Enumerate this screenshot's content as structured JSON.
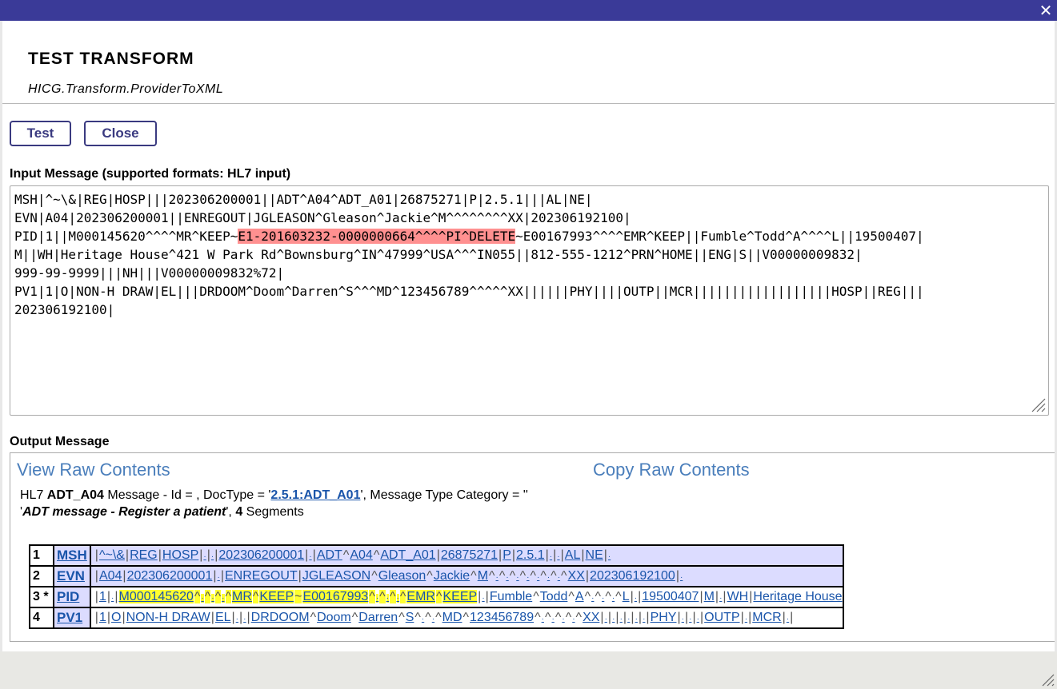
{
  "title": "TEST TRANSFORM",
  "subtitle": "HICG.Transform.ProviderToXML",
  "close_glyph": "✕",
  "buttons": {
    "test": "Test",
    "close": "Close"
  },
  "input": {
    "label": "Input Message (supported formats: HL7 input)",
    "lines": [
      "MSH|^~\\&|REG|HOSP|||202306200001||ADT^A04^ADT_A01|26875271|P|2.5.1|||AL|NE|",
      "EVN|A04|202306200001||ENREGOUT|JGLEASON^Gleason^Jackie^M^^^^^^^^XX|202306192100|",
      "PID|1||M000145620^^^^MR^KEEP~",
      "E1-201603232-0000000664^^^^PI^DELETE",
      "~E00167993^^^^EMR^KEEP||Fumble^Todd^A^^^^L||19500407|",
      "M||WH|Heritage House^421 W Park Rd^Bownsburg^IN^47999^USA^^^IN055||812-555-1212^PRN^HOME||ENG|S||V00000009832|",
      "999-99-9999|||NH|||V00000009832%72|",
      "PV1|1|O|NON-H DRAW|EL|||DRDOOM^Doom^Darren^S^^^MD^123456789^^^^^XX||||||PHY||||OUTP||MCR||||||||||||||||||HOSP||REG|||",
      "202306192100|"
    ]
  },
  "output": {
    "label": "Output Message",
    "view_raw": "View Raw Contents",
    "copy_raw": "Copy Raw Contents",
    "summary": {
      "prefix": "HL7 ",
      "msg_type": "ADT_A04",
      "mid": " Message - Id = , DocType = '",
      "doctype": "2.5.1:ADT_A01",
      "after_doctype": "', Message Type Category = ''",
      "quote_open": "'",
      "description": "ADT message - Register a patient",
      "after_desc": "', ",
      "segment_count": "4",
      "suffix": " Segments"
    },
    "segments": [
      {
        "num": "1",
        "name": "MSH",
        "tokens": [
          [
            "s",
            "|"
          ],
          [
            "f",
            "^~\\&"
          ],
          [
            "s",
            "|"
          ],
          [
            "f",
            "REG"
          ],
          [
            "s",
            "|"
          ],
          [
            "f",
            "HOSP"
          ],
          [
            "s",
            "|"
          ],
          [
            "e",
            "·"
          ],
          [
            "s",
            "|"
          ],
          [
            "e",
            "·"
          ],
          [
            "s",
            "|"
          ],
          [
            "f",
            "202306200001"
          ],
          [
            "s",
            "|"
          ],
          [
            "e",
            "·"
          ],
          [
            "s",
            "|"
          ],
          [
            "f",
            "ADT"
          ],
          [
            "s",
            "^"
          ],
          [
            "f",
            "A04"
          ],
          [
            "s",
            "^"
          ],
          [
            "f",
            "ADT_A01"
          ],
          [
            "s",
            "|"
          ],
          [
            "f",
            "26875271"
          ],
          [
            "s",
            "|"
          ],
          [
            "f",
            "P"
          ],
          [
            "s",
            "|"
          ],
          [
            "f",
            "2.5.1"
          ],
          [
            "s",
            "|"
          ],
          [
            "e",
            "·"
          ],
          [
            "s",
            "|"
          ],
          [
            "e",
            "·"
          ],
          [
            "s",
            "|"
          ],
          [
            "f",
            "AL"
          ],
          [
            "s",
            "|"
          ],
          [
            "f",
            "NE"
          ],
          [
            "s",
            "|"
          ],
          [
            "e",
            "·"
          ]
        ]
      },
      {
        "num": "2",
        "name": "EVN",
        "tokens": [
          [
            "s",
            "|"
          ],
          [
            "f",
            "A04"
          ],
          [
            "s",
            "|"
          ],
          [
            "f",
            "202306200001"
          ],
          [
            "s",
            "|"
          ],
          [
            "e",
            "·"
          ],
          [
            "s",
            "|"
          ],
          [
            "f",
            "ENREGOUT"
          ],
          [
            "s",
            "|"
          ],
          [
            "f",
            "JGLEASON"
          ],
          [
            "s",
            "^"
          ],
          [
            "f",
            "Gleason"
          ],
          [
            "s",
            "^"
          ],
          [
            "f",
            "Jackie"
          ],
          [
            "s",
            "^"
          ],
          [
            "f",
            "M"
          ],
          [
            "s",
            "^"
          ],
          [
            "e",
            "·"
          ],
          [
            "s",
            "^"
          ],
          [
            "e",
            "·"
          ],
          [
            "s",
            "^"
          ],
          [
            "e",
            "·"
          ],
          [
            "s",
            "^"
          ],
          [
            "e",
            "·"
          ],
          [
            "s",
            "^"
          ],
          [
            "e",
            "·"
          ],
          [
            "s",
            "^"
          ],
          [
            "e",
            "·"
          ],
          [
            "s",
            "^"
          ],
          [
            "e",
            "·"
          ],
          [
            "s",
            "^"
          ],
          [
            "f",
            "XX"
          ],
          [
            "s",
            "|"
          ],
          [
            "f",
            "202306192100"
          ],
          [
            "s",
            "|"
          ],
          [
            "e",
            "·"
          ]
        ]
      },
      {
        "num": "3 *",
        "name": "PID",
        "tokens": [
          [
            "s",
            "|"
          ],
          [
            "f",
            "1"
          ],
          [
            "s",
            "|"
          ],
          [
            "e",
            "·"
          ],
          [
            "s",
            "|"
          ],
          [
            "yf",
            "M000145620"
          ],
          [
            "ys",
            "^"
          ],
          [
            "ye",
            "·"
          ],
          [
            "ys",
            "^"
          ],
          [
            "ye",
            "·"
          ],
          [
            "ys",
            "^"
          ],
          [
            "ye",
            "·"
          ],
          [
            "ys",
            "^"
          ],
          [
            "yf",
            "MR"
          ],
          [
            "ys",
            "^"
          ],
          [
            "yf",
            "KEEP"
          ],
          [
            "ys",
            "~"
          ],
          [
            "yf",
            "E00167993"
          ],
          [
            "ys",
            "^"
          ],
          [
            "ye",
            "·"
          ],
          [
            "ys",
            "^"
          ],
          [
            "ye",
            "·"
          ],
          [
            "ys",
            "^"
          ],
          [
            "ye",
            "·"
          ],
          [
            "ys",
            "^"
          ],
          [
            "yf",
            "EMR"
          ],
          [
            "ys",
            "^"
          ],
          [
            "yf",
            "KEEP"
          ],
          [
            "s",
            "|"
          ],
          [
            "e",
            "·"
          ],
          [
            "s",
            "|"
          ],
          [
            "f",
            "Fumble"
          ],
          [
            "s",
            "^"
          ],
          [
            "f",
            "Todd"
          ],
          [
            "s",
            "^"
          ],
          [
            "f",
            "A"
          ],
          [
            "s",
            "^"
          ],
          [
            "e",
            "·"
          ],
          [
            "s",
            "^"
          ],
          [
            "e",
            "·"
          ],
          [
            "s",
            "^"
          ],
          [
            "e",
            "·"
          ],
          [
            "s",
            "^"
          ],
          [
            "f",
            "L"
          ],
          [
            "s",
            "|"
          ],
          [
            "e",
            "·"
          ],
          [
            "s",
            "|"
          ],
          [
            "f",
            "19500407"
          ],
          [
            "s",
            "|"
          ],
          [
            "f",
            "M"
          ],
          [
            "s",
            "|"
          ],
          [
            "e",
            "·"
          ],
          [
            "s",
            "|"
          ],
          [
            "f",
            "WH"
          ],
          [
            "s",
            "|"
          ],
          [
            "f",
            "Heritage House"
          ]
        ]
      },
      {
        "num": "4",
        "name": "PV1",
        "tokens": [
          [
            "s",
            "|"
          ],
          [
            "f",
            "1"
          ],
          [
            "s",
            "|"
          ],
          [
            "f",
            "O"
          ],
          [
            "s",
            "|"
          ],
          [
            "f",
            "NON-H DRAW"
          ],
          [
            "s",
            "|"
          ],
          [
            "f",
            "EL"
          ],
          [
            "s",
            "|"
          ],
          [
            "e",
            "·"
          ],
          [
            "s",
            "|"
          ],
          [
            "e",
            "·"
          ],
          [
            "s",
            "|"
          ],
          [
            "f",
            "DRDOOM"
          ],
          [
            "s",
            "^"
          ],
          [
            "f",
            "Doom"
          ],
          [
            "s",
            "^"
          ],
          [
            "f",
            "Darren"
          ],
          [
            "s",
            "^"
          ],
          [
            "f",
            "S"
          ],
          [
            "s",
            "^"
          ],
          [
            "e",
            "·"
          ],
          [
            "s",
            "^"
          ],
          [
            "e",
            "·"
          ],
          [
            "s",
            "^"
          ],
          [
            "f",
            "MD"
          ],
          [
            "s",
            "^"
          ],
          [
            "f",
            "123456789"
          ],
          [
            "s",
            "^"
          ],
          [
            "e",
            "·"
          ],
          [
            "s",
            "^"
          ],
          [
            "e",
            "·"
          ],
          [
            "s",
            "^"
          ],
          [
            "e",
            "·"
          ],
          [
            "s",
            "^"
          ],
          [
            "e",
            "·"
          ],
          [
            "s",
            "^"
          ],
          [
            "f",
            "XX"
          ],
          [
            "s",
            "|"
          ],
          [
            "e",
            "·"
          ],
          [
            "s",
            "|"
          ],
          [
            "e",
            "·"
          ],
          [
            "s",
            "|"
          ],
          [
            "e",
            "·"
          ],
          [
            "s",
            "|"
          ],
          [
            "e",
            "·"
          ],
          [
            "s",
            "|"
          ],
          [
            "e",
            "·"
          ],
          [
            "s",
            "|"
          ],
          [
            "e",
            "·"
          ],
          [
            "s",
            "|"
          ],
          [
            "f",
            "PHY"
          ],
          [
            "s",
            "|"
          ],
          [
            "e",
            "·"
          ],
          [
            "s",
            "|"
          ],
          [
            "e",
            "·"
          ],
          [
            "s",
            "|"
          ],
          [
            "e",
            "·"
          ],
          [
            "s",
            "|"
          ],
          [
            "f",
            "OUTP"
          ],
          [
            "s",
            "|"
          ],
          [
            "e",
            "·"
          ],
          [
            "s",
            "|"
          ],
          [
            "f",
            "MCR"
          ],
          [
            "s",
            "|"
          ],
          [
            "e",
            "·"
          ],
          [
            "s",
            "|"
          ]
        ]
      }
    ]
  }
}
